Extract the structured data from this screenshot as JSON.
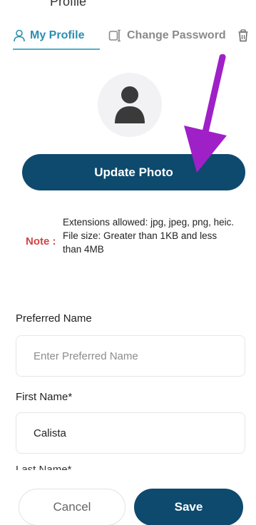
{
  "header": {
    "title": "Profile"
  },
  "tabs": [
    {
      "label": "My Profile",
      "icon": "person-icon",
      "active": true
    },
    {
      "label": "Change Password",
      "icon": "password-icon",
      "active": false
    },
    {
      "label": "",
      "icon": "trash-icon",
      "active": false
    }
  ],
  "photo": {
    "button_label": "Update Photo"
  },
  "note": {
    "label": "Note :",
    "lines": [
      "Extensions allowed: jpg, jpeg, png, heic.",
      "File size: Greater than 1KB and less than 4MB"
    ]
  },
  "form": {
    "preferred_name": {
      "label": "Preferred Name",
      "value": "",
      "placeholder": "Enter Preferred Name"
    },
    "first_name": {
      "label": "First Name*",
      "value": "Calista"
    },
    "last_name": {
      "label": "Last Name*"
    }
  },
  "actions": {
    "cancel_label": "Cancel",
    "save_label": "Save"
  },
  "colors": {
    "primary": "#0d4a6e",
    "accent": "#2b8fb0",
    "note": "#d04646",
    "annotation_arrow": "#a020c8"
  }
}
